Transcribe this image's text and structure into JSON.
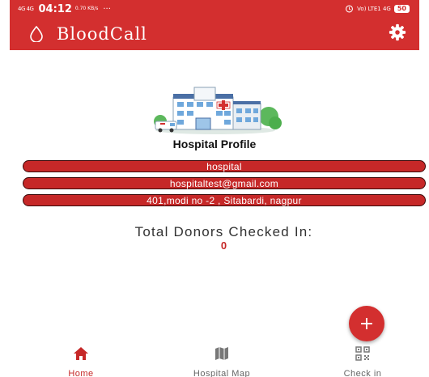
{
  "status_bar": {
    "network": "4G 4G",
    "time": "04:12",
    "speed": "0.70 KB/s",
    "dots": "···",
    "right_icons": "Vo) LTE1 4G",
    "battery": "50"
  },
  "app_bar": {
    "title": "BloodCall",
    "logo_icon": "blood-drop-icon",
    "settings_icon": "gear-icon"
  },
  "profile": {
    "title": "Hospital Profile",
    "name": "hospital",
    "email": "hospitaltest@gmail.com",
    "address": "401,modi no -2 , Sitabardi, nagpur"
  },
  "donors": {
    "label": "Total Donors Checked In:",
    "count": "0"
  },
  "fab": {
    "label": "+"
  },
  "bottom_nav": {
    "items": [
      {
        "label": "Home",
        "icon": "home-icon",
        "active": true
      },
      {
        "label": "Hospital Map",
        "icon": "map-icon",
        "active": false
      },
      {
        "label": "Check in",
        "icon": "qr-code-icon",
        "active": false
      }
    ]
  },
  "colors": {
    "primary": "#d32f2f",
    "pill": "#c62828",
    "inactive": "#666666"
  }
}
